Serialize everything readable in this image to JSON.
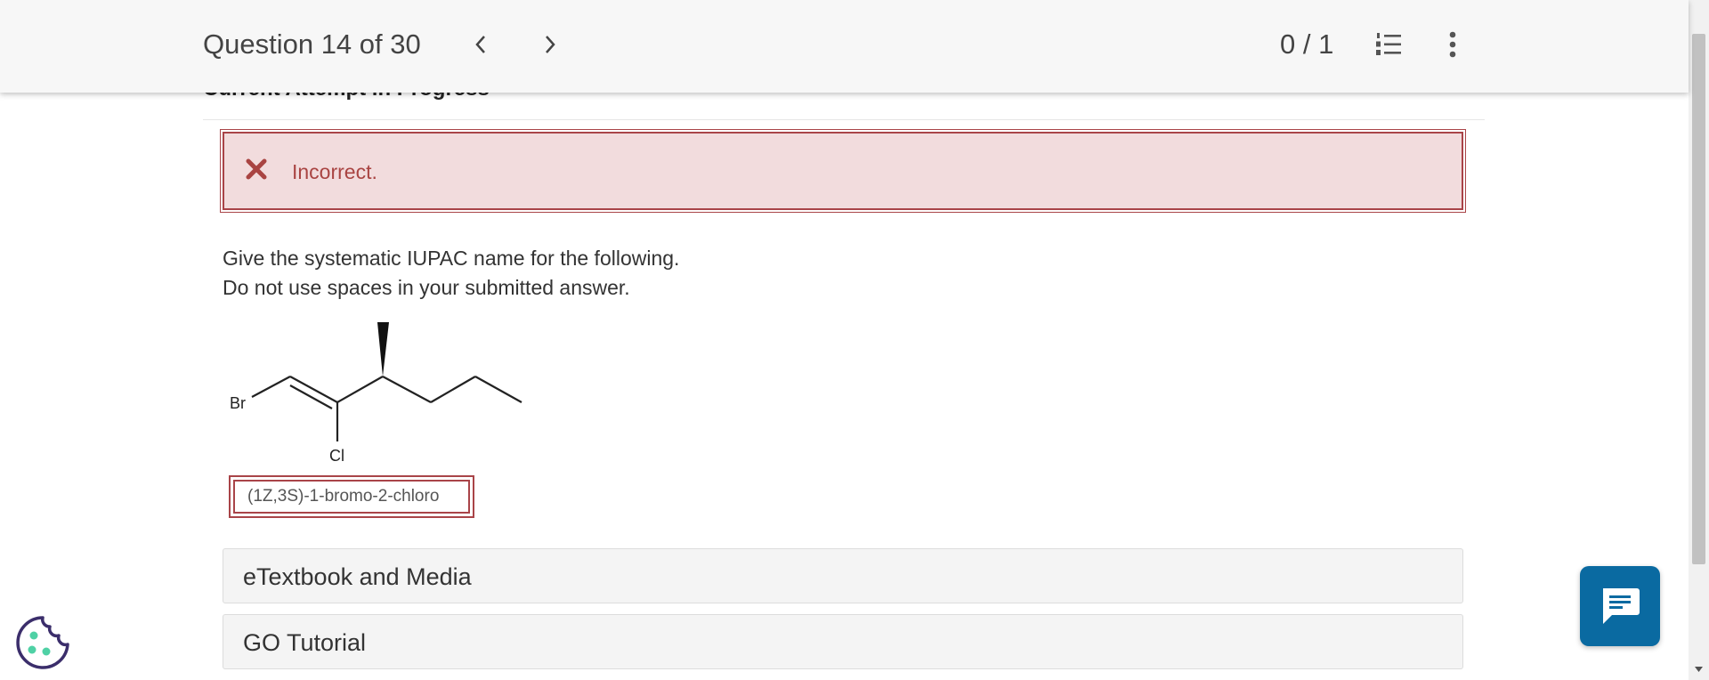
{
  "header": {
    "question_label": "Question 14 of 30",
    "score": "0 / 1"
  },
  "attempt": {
    "heading": "Current Attempt in Progress"
  },
  "alert": {
    "message": "Incorrect.",
    "color": "#a94442",
    "background": "#f2dcdd"
  },
  "question": {
    "line1": "Give the systematic IUPAC name for the following.",
    "line2": "Do not use spaces in your submitted answer."
  },
  "molecule": {
    "label_br": "Br",
    "label_cl": "Cl"
  },
  "answer": {
    "value": "(1Z,3S)-1-bromo-2-chloro"
  },
  "panels": [
    {
      "label": "eTextbook and Media"
    },
    {
      "label": "GO Tutorial"
    }
  ],
  "icons": {
    "prev": "chevron-left-icon",
    "next": "chevron-right-icon",
    "list": "numbered-list-icon",
    "more": "kebab-menu-icon",
    "chat": "chat-icon",
    "cookie": "cookie-icon"
  },
  "colors": {
    "chat_button": "#0a6aa1",
    "error_border": "#a94448"
  }
}
